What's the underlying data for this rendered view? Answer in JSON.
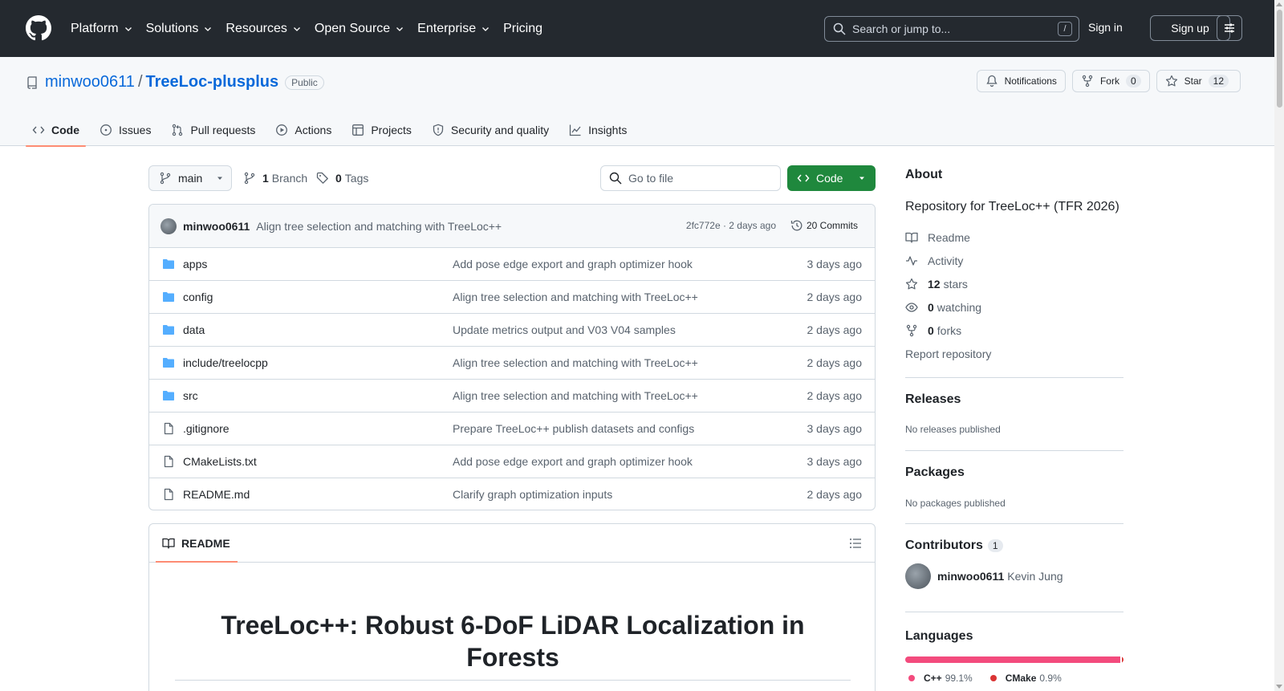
{
  "header": {
    "nav": [
      "Platform",
      "Solutions",
      "Resources",
      "Open Source",
      "Enterprise",
      "Pricing"
    ],
    "search_placeholder": "Search or jump to...",
    "search_shortcut": "/",
    "sign_in": "Sign in",
    "sign_up": "Sign up"
  },
  "repo": {
    "owner": "minwoo0611",
    "separator": "/",
    "name": "TreeLoc-plusplus",
    "visibility": "Public",
    "notifications_label": "Notifications",
    "fork_label": "Fork",
    "fork_count": "0",
    "star_label": "Star",
    "star_count": "12"
  },
  "tabs": [
    "Code",
    "Issues",
    "Pull requests",
    "Actions",
    "Projects",
    "Security and quality",
    "Insights"
  ],
  "toolbar": {
    "branch": "main",
    "branches_count": "1",
    "branches_label": "Branch",
    "tags_count": "0",
    "tags_label": "Tags",
    "goto_placeholder": "Go to file",
    "code_button": "Code"
  },
  "latest_commit": {
    "author": "minwoo0611",
    "message": "Align tree selection and matching with TreeLoc++",
    "hash_age": "2fc772e · 2 days ago",
    "commits": "20 Commits"
  },
  "files": [
    {
      "name": "apps",
      "type": "folder",
      "commit": "Add pose edge export and graph optimizer hook",
      "age": "3 days ago"
    },
    {
      "name": "config",
      "type": "folder",
      "commit": "Align tree selection and matching with TreeLoc++",
      "age": "2 days ago"
    },
    {
      "name": "data",
      "type": "folder",
      "commit": "Update metrics output and V03 V04 samples",
      "age": "2 days ago"
    },
    {
      "name": "include/treelocpp",
      "type": "folder",
      "commit": "Align tree selection and matching with TreeLoc++",
      "age": "2 days ago"
    },
    {
      "name": "src",
      "type": "folder",
      "commit": "Align tree selection and matching with TreeLoc++",
      "age": "2 days ago"
    },
    {
      "name": ".gitignore",
      "type": "file",
      "commit": "Prepare TreeLoc++ publish datasets and configs",
      "age": "3 days ago"
    },
    {
      "name": "CMakeLists.txt",
      "type": "file",
      "commit": "Add pose edge export and graph optimizer hook",
      "age": "3 days ago"
    },
    {
      "name": "README.md",
      "type": "file",
      "commit": "Clarify graph optimization inputs",
      "age": "2 days ago"
    }
  ],
  "readme": {
    "tab": "README",
    "title": "TreeLoc++: Robust 6-DoF LiDAR Localization in Forests"
  },
  "about": {
    "title": "About",
    "description": "Repository for TreeLoc++ (TFR 2026)",
    "readme": "Readme",
    "activity": "Activity",
    "stars_count": "12",
    "stars_label": "stars",
    "watching_count": "0",
    "watching_label": "watching",
    "forks_count": "0",
    "forks_label": "forks",
    "report": "Report repository"
  },
  "releases": {
    "title": "Releases",
    "note": "No releases published"
  },
  "packages": {
    "title": "Packages",
    "note": "No packages published"
  },
  "contributors": {
    "title": "Contributors",
    "count": "1",
    "login": "minwoo0611",
    "full_name": "Kevin Jung"
  },
  "languages": {
    "title": "Languages",
    "items": [
      {
        "name": "C++",
        "percent": "99.1%",
        "share": 99.1,
        "color": "#f34b7d"
      },
      {
        "name": "CMake",
        "percent": "0.9%",
        "share": 0.9,
        "color": "#DA3434"
      }
    ]
  },
  "colors": {
    "header_bg": "#24292f",
    "accent_blue": "#0969da",
    "code_green": "#1f883d",
    "tab_underline": "#fd8c73",
    "folder_blue": "#54aeff"
  }
}
